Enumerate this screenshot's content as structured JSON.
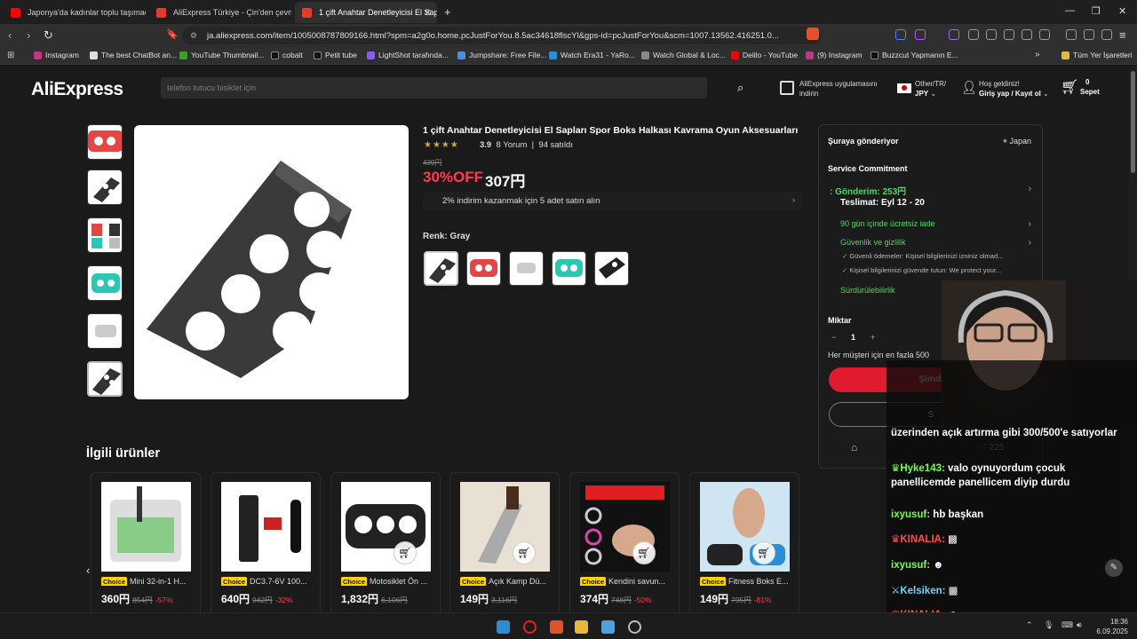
{
  "browser": {
    "tabs": [
      {
        "label": "Japonya'da kadınlar toplu taşımada"
      },
      {
        "label": "AliExpress Türkiye - Çin'den çevrimiç"
      },
      {
        "label": "1 çift Anahtar Denetleyicisi El Sap"
      }
    ],
    "url": "ja.aliexpress.com/item/1005008787809166.html?spm=a2g0o.home.pcJustForYou.8.5ac34618flscYl&gps-id=pcJustForYou&scm=1007.13562.416251.0...",
    "bookmarks": [
      "Instagram",
      "The best ChatBot an...",
      "YouTube Thumbnail...",
      "cobalt",
      "Petit tube",
      "LightShot tarafında...",
      "Jumpshare: Free File...",
      "Watch Era31 - YaRo...",
      "Watch Global & Loc...",
      "Delilo - YouTube",
      "(9) Instagram",
      "Buzzcut Yapmanın E..."
    ],
    "bookmarks_all": "Tüm Yer İşaretleri"
  },
  "header": {
    "logo": "AliExpress",
    "search_placeholder": "telefon tutucu bisiklet için",
    "app_line1": "AliExpress uygulamasını",
    "app_line2": "indirin",
    "region_line1": "Other/TR/",
    "region_line2": "JPY",
    "account_line1": "Hoş geldiniz!",
    "account_line2": "Giriş yap / Kayıt ol",
    "cart_count": "0",
    "cart_label": "Sepet"
  },
  "product": {
    "title": "1 çift Anahtar Denetleyicisi El Sapları Spor Boks Halkası Kavrama Oyun Aksesuarları",
    "stars": "★★★★",
    "rating": "3.9",
    "reviews": "8 Yorum",
    "sold": "94 satıldı",
    "old_price": "439円",
    "discount": "30%OFF",
    "price": "307円",
    "promo": "2% indirim kazanmak için 5 adet satın alın",
    "color_label": "Renk: Gray"
  },
  "panel": {
    "ship_to": "Şuraya gönderiyor",
    "country": "Japan",
    "service": "Service Commitment",
    "shipping": "Gönderim: 253円",
    "delivery": "Teslimat: Eyl 12 - 20",
    "returns": "90 gün içinde ücretsiz iade",
    "security": "Güvenlik ve gizlilik",
    "sec1": "Güvenli ödemeler: Kişisel bilgilerinizi izniniz olmad...",
    "sec2": "Kişisel bilgilerinizi güvende tutun: We protect your...",
    "sustain": "Sürdürülebilirlik",
    "qty_label": "Miktar",
    "qty": "1",
    "limit": "Her müşteri için en fazla 500",
    "buy": "Şimdi",
    "cart": "S",
    "wishlist": "225"
  },
  "related": {
    "title": "İlgili ürünler",
    "items": [
      {
        "name": "Mini 32-in-1 H...",
        "price": "360円",
        "old": "854円",
        "disc": "-57%"
      },
      {
        "name": "DC3.7-6V 100...",
        "price": "640円",
        "old": "942円",
        "disc": "-32%"
      },
      {
        "name": "Motosiklet Ön ...",
        "price": "1,832円",
        "old": "6,106円",
        "disc": ""
      },
      {
        "name": "Açık Kamp Dü...",
        "price": "149円",
        "old": "3,116円",
        "disc": ""
      },
      {
        "name": "Kendini savun...",
        "price": "374円",
        "old": "748円",
        "disc": "-50%"
      },
      {
        "name": "Fitness Boks E...",
        "price": "149円",
        "old": "795円",
        "disc": "-81%"
      }
    ],
    "choice": "Choice"
  },
  "chat": [
    {
      "user": "",
      "text": "üzerinden açık artırma gibi 300/500'e satıyorlar"
    },
    {
      "user": "Hyke143:",
      "text": " valo oynuyordum çocuk panellicemde panellicem diyip durdu"
    },
    {
      "user": "ixyusuf:",
      "text": " hb başkan"
    },
    {
      "user": "KINALIA:",
      "text": ""
    },
    {
      "user": "ixyusuf:",
      "text": ""
    },
    {
      "user": "Kelsiken:",
      "text": ""
    },
    {
      "user": "KINALIA:",
      "text": ""
    }
  ],
  "taskbar": {
    "time": "18:36",
    "date": "6.09.2025"
  }
}
